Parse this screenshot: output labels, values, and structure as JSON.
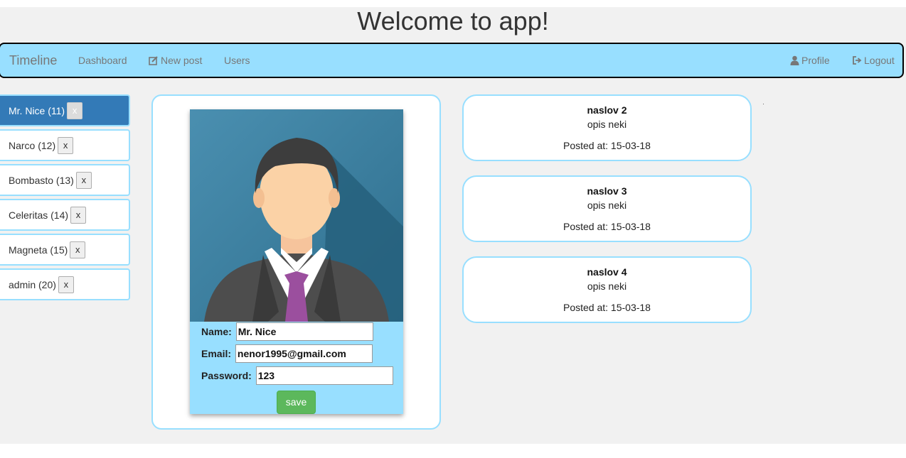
{
  "header": {
    "title": "Welcome to app!"
  },
  "navbar": {
    "brand": "Timeline",
    "links": [
      {
        "label": "Dashboard",
        "icon": ""
      },
      {
        "label": "New post",
        "icon": "edit-icon"
      },
      {
        "label": "Users",
        "icon": ""
      }
    ],
    "right_links": [
      {
        "label": "Profile",
        "icon": "user-icon"
      },
      {
        "label": "Logout",
        "icon": "logout-icon"
      }
    ],
    "bg_color": "#98dfff"
  },
  "users": [
    {
      "label": "Mr. Nice (11)",
      "delete": "x",
      "active": true
    },
    {
      "label": "Narco (12)",
      "delete": "x",
      "active": false
    },
    {
      "label": "Bombasto (13)",
      "delete": "x",
      "active": false
    },
    {
      "label": "Celeritas (14)",
      "delete": "x",
      "active": false
    },
    {
      "label": "Magneta (15)",
      "delete": "x",
      "active": false
    },
    {
      "label": "admin (20)",
      "delete": "x",
      "active": false
    }
  ],
  "profile": {
    "name_label": "Name:",
    "name_value": "Mr. Nice",
    "email_label": "Email:",
    "email_value": "nenor1995@gmail.com",
    "password_label": "Password:",
    "password_value": "123",
    "save_label": "save"
  },
  "posts": [
    {
      "title": "naslov 2",
      "description": "opis neki",
      "date": "Posted at: 15-03-18"
    },
    {
      "title": "naslov 3",
      "description": "opis neki",
      "date": "Posted at: 15-03-18"
    },
    {
      "title": "naslov 4",
      "description": "opis neki",
      "date": "Posted at: 15-03-18"
    }
  ],
  "colors": {
    "accent": "#98dfff",
    "active": "#337ab7",
    "save": "#5cb85c"
  }
}
